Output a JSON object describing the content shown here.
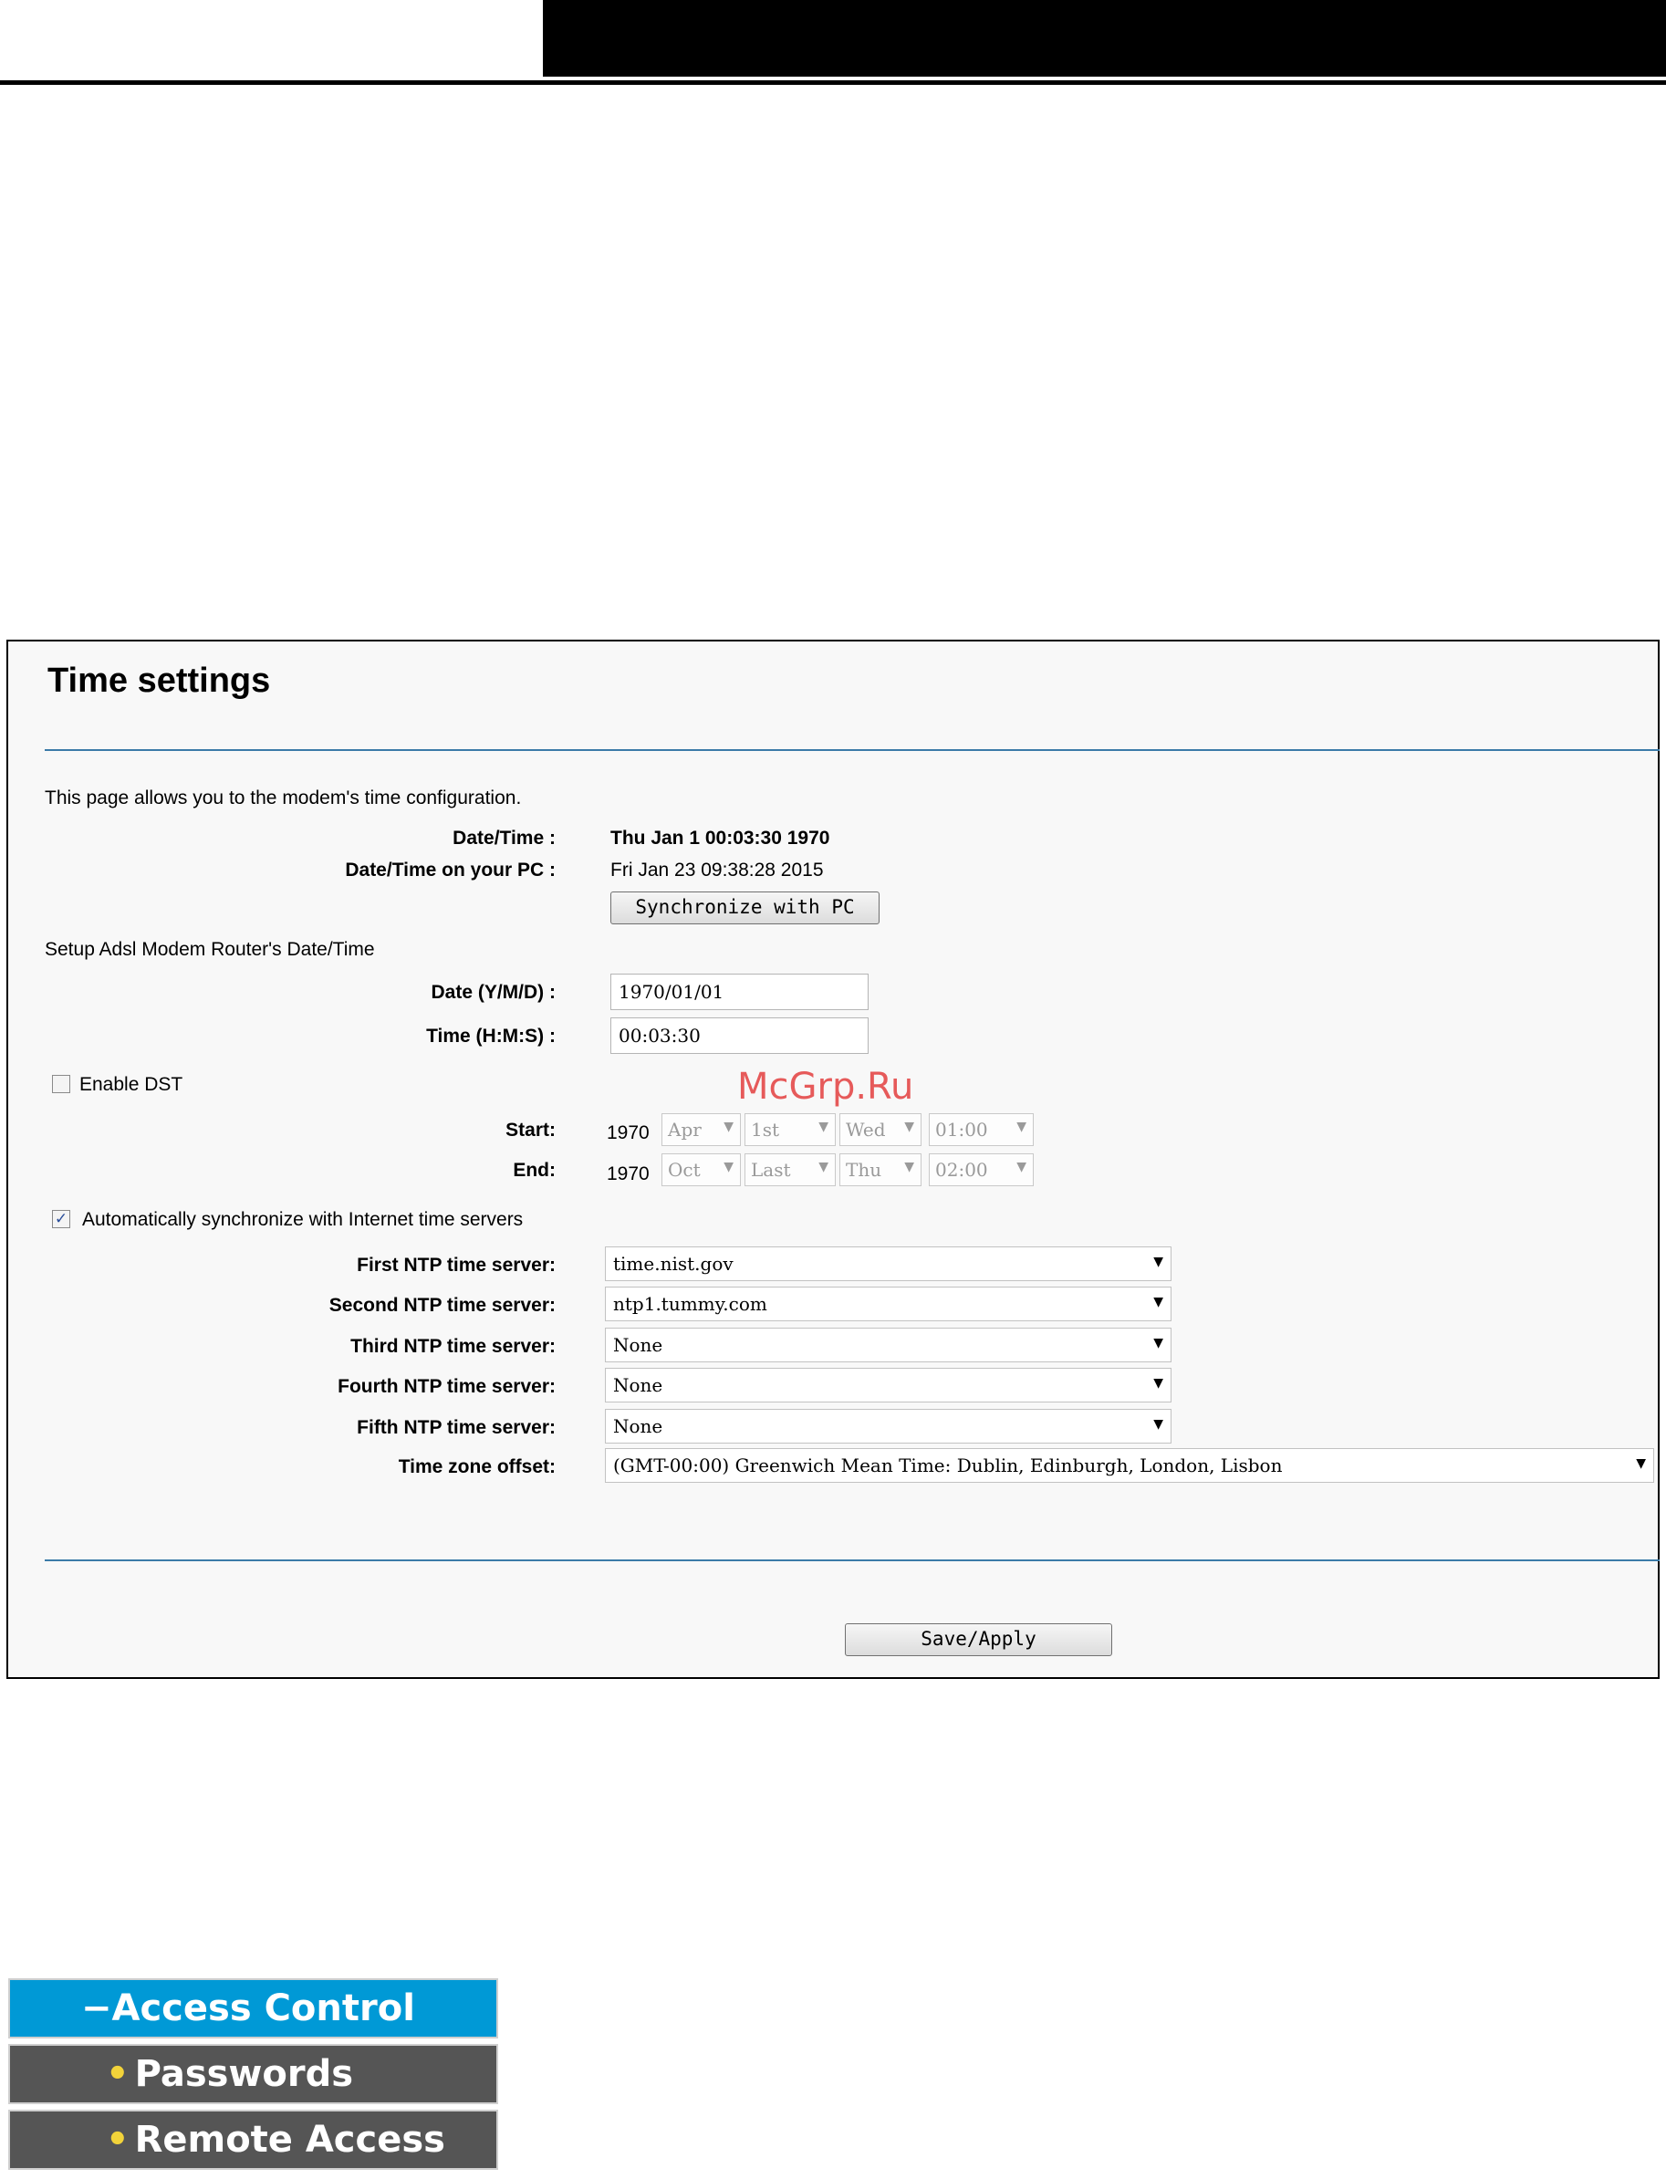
{
  "page_title": "Time settings",
  "intro": "This page allows you to the modem's time configuration.",
  "datetime_label": "Date/Time :",
  "datetime_value": "Thu Jan 1 00:03:30 1970",
  "pc_label": "Date/Time on your PC :",
  "pc_value": "Fri Jan 23 09:38:28 2015",
  "sync_button": "Synchronize with PC",
  "setup_heading": "Setup Adsl Modem Router's Date/Time",
  "date_label": "Date (Y/M/D) :",
  "date_value": "1970/01/01",
  "time_label": "Time (H:M:S) :",
  "time_value": "00:03:30",
  "dst": {
    "label": "Enable DST",
    "checked": false,
    "start_label": "Start:",
    "end_label": "End:",
    "start": {
      "year": "1970",
      "month": "Apr",
      "week": "1st",
      "day": "Wed",
      "time": "01:00"
    },
    "end": {
      "year": "1970",
      "month": "Oct",
      "week": "Last",
      "day": "Thu",
      "time": "02:00"
    }
  },
  "auto_sync": {
    "label": "Automatically synchronize with Internet time servers",
    "checked": true
  },
  "ntp": [
    {
      "label": "First NTP time server:",
      "value": "time.nist.gov"
    },
    {
      "label": "Second NTP time server:",
      "value": "ntp1.tummy.com"
    },
    {
      "label": "Third NTP time server:",
      "value": "None"
    },
    {
      "label": "Fourth NTP time server:",
      "value": "None"
    },
    {
      "label": "Fifth NTP time server:",
      "value": "None"
    }
  ],
  "tz": {
    "label": "Time zone offset:",
    "value": "(GMT-00:00) Greenwich Mean Time: Dublin, Edinburgh, London, Lisbon"
  },
  "save_button": "Save/Apply",
  "watermark": "McGrp.Ru",
  "menu": {
    "head": "Access Control",
    "items": [
      "Passwords",
      "Remote Access"
    ]
  }
}
